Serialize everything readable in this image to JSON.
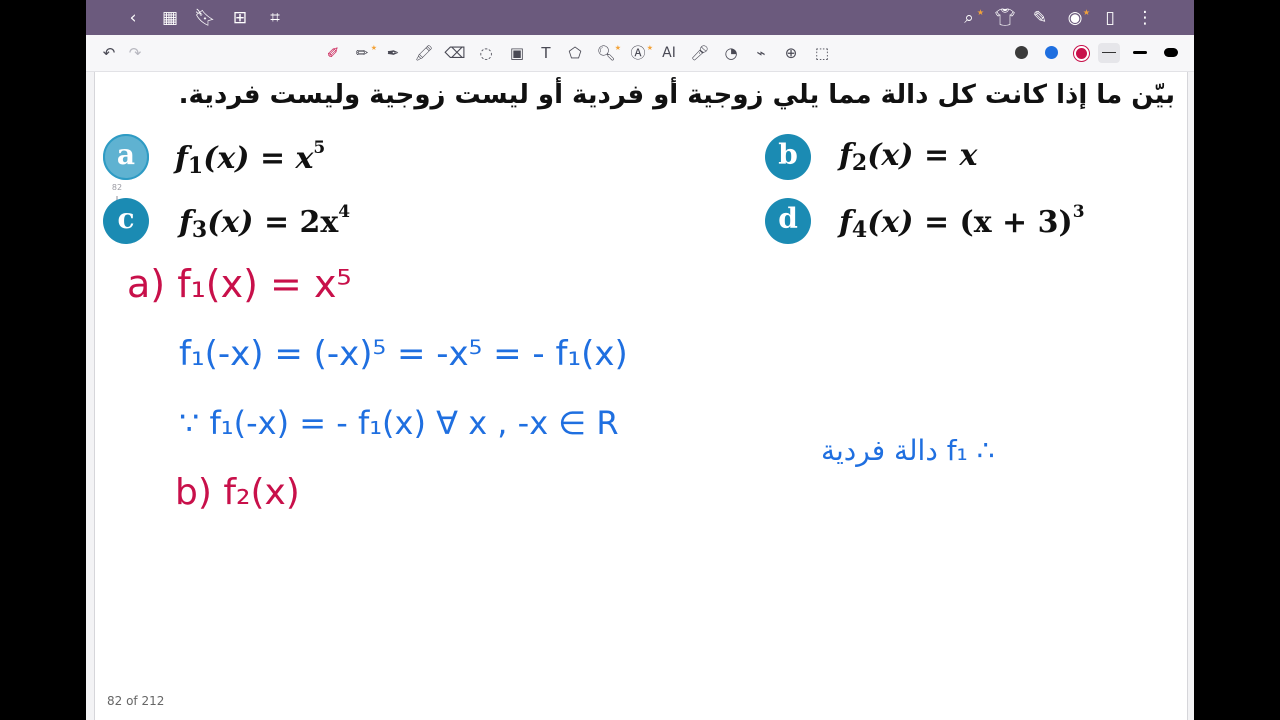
{
  "icons": {
    "back": "chevron-left-icon",
    "grid": "grid-icon",
    "bookmark": "bookmark-icon",
    "add_page": "add-page-icon",
    "crop": "crop-icon",
    "search": "search-icon",
    "shirt": "shirt-icon",
    "pen": "pen-icon",
    "eye": "eye-icon",
    "document": "document-icon",
    "more": "more-vertical-icon"
  },
  "toolbar": {
    "ai_label": "AI",
    "palette": [
      "#3b3b3b",
      "#1f6fe0",
      "#c8104a",
      "#cfcfcf",
      "#000000",
      "#000000"
    ]
  },
  "scroller": {
    "page_label": "82"
  },
  "question": {
    "text": "بيّن ما إذا كانت كل دالة مما يلي زوجية أو فردية أو ليست زوجية وليست فردية."
  },
  "items": [
    {
      "badge": "a",
      "f": "f",
      "sub": "1",
      "arg": "(x)",
      "eq": " = ",
      "rhs": "x",
      "exp": "5"
    },
    {
      "badge": "b",
      "f": "f",
      "sub": "2",
      "arg": "(x)",
      "eq": " = ",
      "rhs": "x",
      "exp": ""
    },
    {
      "badge": "c",
      "f": "f",
      "sub": "3",
      "arg": "(x)",
      "eq": " = ",
      "rhs": "2x",
      "exp": "4"
    },
    {
      "badge": "d",
      "f": "f",
      "sub": "4",
      "arg": "(x)",
      "eq": " = ",
      "rhs": "(x + 3)",
      "exp": "3"
    }
  ],
  "handwriting": {
    "line1": "a) f₁(x) = x⁵",
    "line2": "f₁(-x) = (-x)⁵ = -x⁵ = - f₁(x)",
    "line3": "∵ f₁(-x) = - f₁(x)  ∀ x , -x ∈ R",
    "arabic_note": "∴ f₁ دالة فردية",
    "line4": "b) f₂(x)"
  },
  "footer": {
    "page_count": "82 of 212"
  }
}
